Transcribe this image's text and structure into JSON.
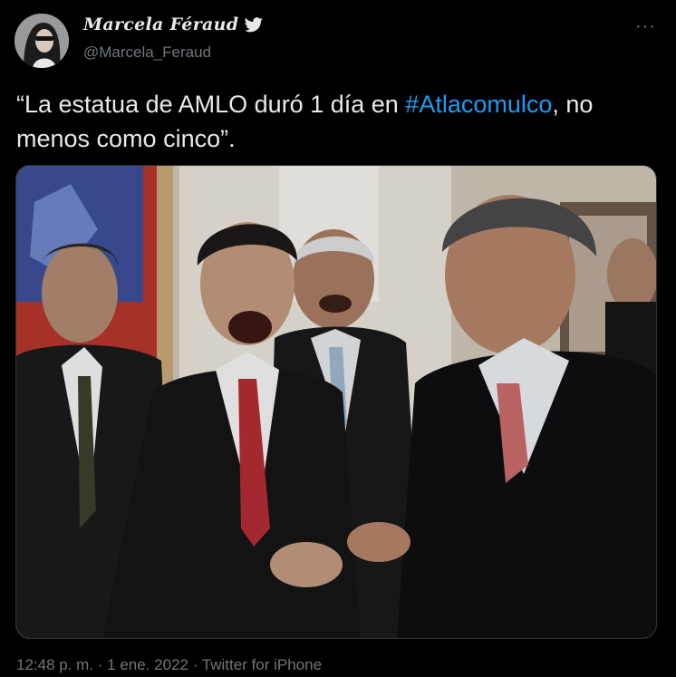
{
  "author": {
    "display_name": "Marcela Féraud",
    "handle": "@Marcela_Feraud",
    "avatar_icon": "profile-photo",
    "bird_icon": "twitter-bird-icon"
  },
  "more_label": "···",
  "tweet": {
    "text_before": "“La estatua de AMLO duró 1 día en ",
    "hashtag": "#Atlacomulco",
    "text_after": ", no menos como cinco”."
  },
  "meta": {
    "time": "12:48 p. m.",
    "separator": " · ",
    "date": "1 ene. 2022",
    "source": "Twitter for iPhone"
  },
  "colors": {
    "background": "#000000",
    "text": "#e7e9ea",
    "secondary": "#71767b",
    "link": "#1d9bf0"
  }
}
